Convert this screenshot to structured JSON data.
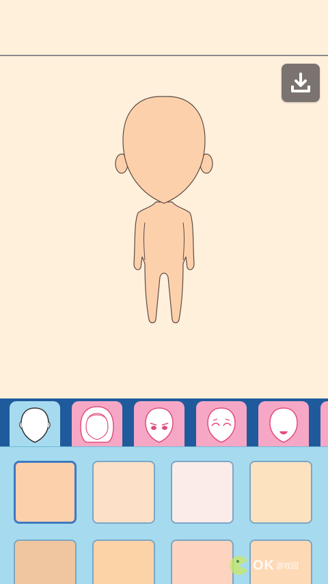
{
  "toolbar": {
    "download_icon": "download-icon"
  },
  "tabs": [
    {
      "name": "face-shape",
      "icon": "face-shape-icon",
      "active": true
    },
    {
      "name": "hair",
      "icon": "hair-icon",
      "active": false
    },
    {
      "name": "eyes-angry",
      "icon": "eyes-icon",
      "active": false
    },
    {
      "name": "eyes-closed",
      "icon": "eyes-closed-icon",
      "active": false
    },
    {
      "name": "mouth",
      "icon": "mouth-icon",
      "active": false
    },
    {
      "name": "more",
      "icon": "more-icon",
      "active": false
    }
  ],
  "skin_colors": [
    {
      "color": "#fdd0ac",
      "selected": true
    },
    {
      "color": "#fde0c8",
      "selected": false
    },
    {
      "color": "#fbecea",
      "selected": false
    },
    {
      "color": "#fde2c0",
      "selected": false
    },
    {
      "color": "#f0c6a0",
      "selected": false
    },
    {
      "color": "#fcd3a6",
      "selected": false
    },
    {
      "color": "#fdd4c0",
      "selected": false
    },
    {
      "color": "#fdd9b6",
      "selected": false
    }
  ],
  "colors": {
    "background": "#fff0dc",
    "tab_bar": "#1f5b9c",
    "tab_active": "#a6dbef",
    "tab_inactive": "#f7a7c6",
    "panel": "#a6dbef",
    "skin": "#fdd0ac"
  },
  "watermark": {
    "brand": "OK",
    "suffix": "游戏园"
  }
}
